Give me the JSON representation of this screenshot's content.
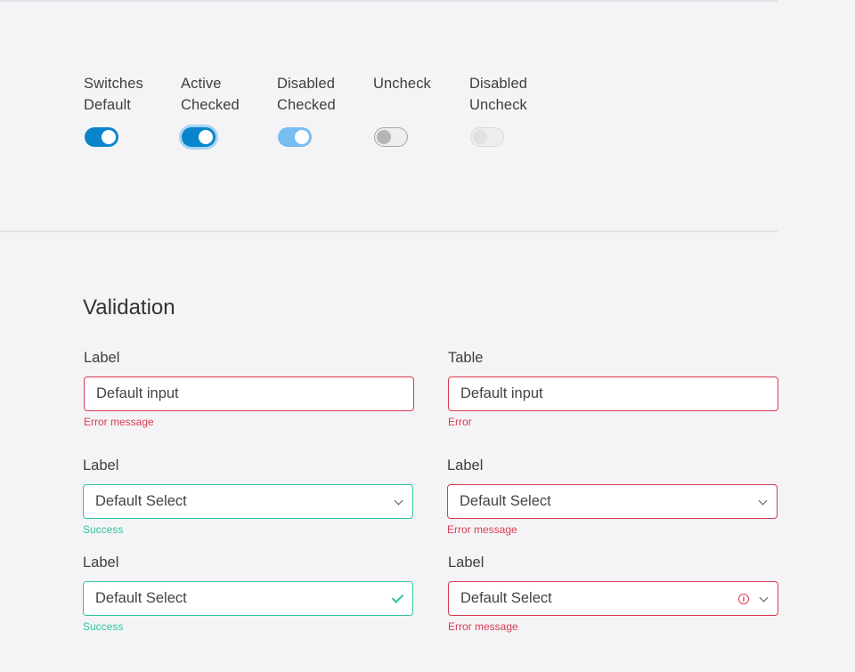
{
  "switches": [
    {
      "label_line1": "Switches",
      "label_line2": "Default",
      "state": "on"
    },
    {
      "label_line1": "Active",
      "label_line2": "Checked",
      "state": "on-focused"
    },
    {
      "label_line1": "Disabled",
      "label_line2": "Checked",
      "state": "on-disabled"
    },
    {
      "label_line1": "Uncheck",
      "label_line2": "",
      "state": "off"
    },
    {
      "label_line1": "Disabled",
      "label_line2": "Uncheck",
      "state": "off-disabled"
    }
  ],
  "validation": {
    "title": "Validation",
    "fields": [
      {
        "label": "Label",
        "value": "Default input",
        "message": "Error message",
        "status": "error"
      },
      {
        "label": "Table",
        "value": "Default input",
        "message": "Error",
        "status": "error"
      },
      {
        "label": "Label",
        "value": "Default Select",
        "message": "Success",
        "status": "success",
        "icon": "chevron-down-icon"
      },
      {
        "label": "Label",
        "value": "Default Select",
        "message": "Error message",
        "status": "error",
        "icon": "chevron-down-icon"
      },
      {
        "label": "Label",
        "value": "Default Select",
        "message": "Success",
        "status": "success",
        "icon": "checkmark-icon"
      },
      {
        "label": "Label",
        "value": "Default Select",
        "message": "Error message",
        "status": "error",
        "icon": "chevron-down-icon",
        "status_icon": "info-icon",
        "status_icon_glyph": "i"
      }
    ]
  },
  "colors": {
    "primary": "#0a85cc",
    "error": "#d83b52",
    "success": "#2ec4a2"
  }
}
